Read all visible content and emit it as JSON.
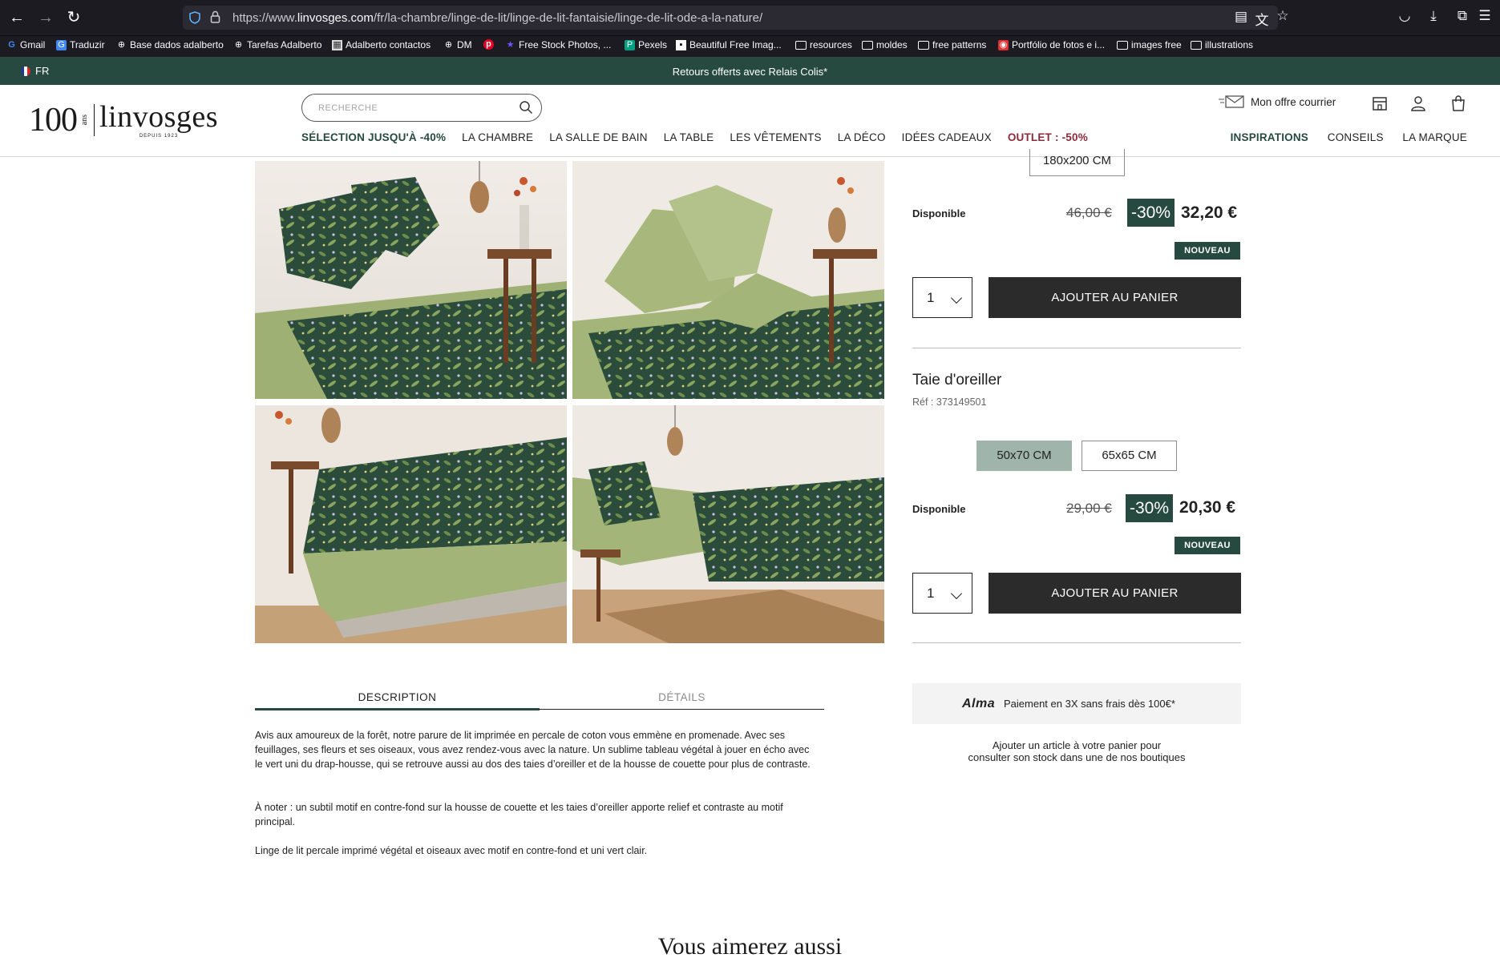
{
  "browser": {
    "url_prefix": "https://www.",
    "url_domain": "linvosges.com",
    "url_path": "/fr/la-chambre/linge-de-lit/linge-de-lit-fantaisie/linge-de-lit-ode-a-la-nature/",
    "bookmarks": [
      {
        "label": "Gmail"
      },
      {
        "label": "Traduzir"
      },
      {
        "label": "Base dados adalberto"
      },
      {
        "label": "Tarefas Adalberto"
      },
      {
        "label": "Adalberto contactos"
      },
      {
        "label": "DM"
      },
      {
        "label": ""
      },
      {
        "label": "Free Stock Photos, ..."
      },
      {
        "label": "Pexels"
      },
      {
        "label": "Beautiful Free Imag..."
      },
      {
        "label": "resources"
      },
      {
        "label": "moldes"
      },
      {
        "label": "free patterns"
      },
      {
        "label": "Portfólio de fotos e i..."
      },
      {
        "label": "images free"
      },
      {
        "label": "illustrations"
      }
    ]
  },
  "promo": {
    "lang": "FR",
    "text": "Retours offerts avec Relais Colis*"
  },
  "header": {
    "logo_100": "100",
    "logo_ans": "ans",
    "logo_name": "linvosges",
    "logo_depuis": "DEPUIS 1923",
    "search_placeholder": "RECHERCHE",
    "courrier": "Mon offre courrier",
    "nav": [
      "SÉLECTION JUSQU'À -40%",
      "LA CHAMBRE",
      "LA SALLE DE BAIN",
      "LA TABLE",
      "LES VÊTEMENTS",
      "LA DÉCO",
      "IDÉES CADEAUX",
      "OUTLET : -50%"
    ],
    "right_nav": [
      "INSPIRATIONS",
      "CONSEILS",
      "LA MARQUE"
    ]
  },
  "product1": {
    "size_visible": "180x200 CM",
    "availability": "Disponible",
    "old_price": "46,00 €",
    "discount": "-30%",
    "price": "32,20 €",
    "badge": "NOUVEAU",
    "qty": "1",
    "cart_label": "AJOUTER AU PANIER"
  },
  "product2": {
    "title": "Taie d'oreiller",
    "ref": "Réf : 373149501",
    "sizes": [
      "50x70 CM",
      "65x65 CM"
    ],
    "selected_size": "50x70 CM",
    "availability": "Disponible",
    "old_price": "29,00 €",
    "discount": "-30%",
    "price": "20,30 €",
    "badge": "NOUVEAU",
    "qty": "1",
    "cart_label": "AJOUTER AU PANIER"
  },
  "alma": {
    "logo": "Alma",
    "text": "Paiement en 3X sans frais dès 100€*"
  },
  "stock_text_1": "Ajouter un article à votre panier pour",
  "stock_text_2": "consulter son stock dans une de nos boutiques",
  "tabs": {
    "description": "DESCRIPTION",
    "details": "DÉTAILS"
  },
  "description": {
    "p1": "Avis aux amoureux de la forêt, notre parure de lit imprimée en percale de coton vous emmène en promenade. Avec ses feuillages, ses fleurs et ses oiseaux, vous avez rendez-vous avec la nature. Un sublime tableau végétal à jouer en écho avec le vert uni du drap-housse, qui se retrouve aussi au dos des taies d’oreiller et de la housse de couette pour plus de contraste.",
    "p2": "À noter : un subtil motif en contre-fond sur la housse de couette et les taies d’oreiller apporte relief et contraste au motif principal.",
    "p3": "Linge de lit percale imprimé végétal et oiseaux avec motif en contre-fond et uni vert clair."
  },
  "related_title": "Vous aimerez aussi",
  "colors": {
    "brand_green": "#264a3f",
    "outlet": "#8a2a3b",
    "sage": "#9fb5ac"
  }
}
